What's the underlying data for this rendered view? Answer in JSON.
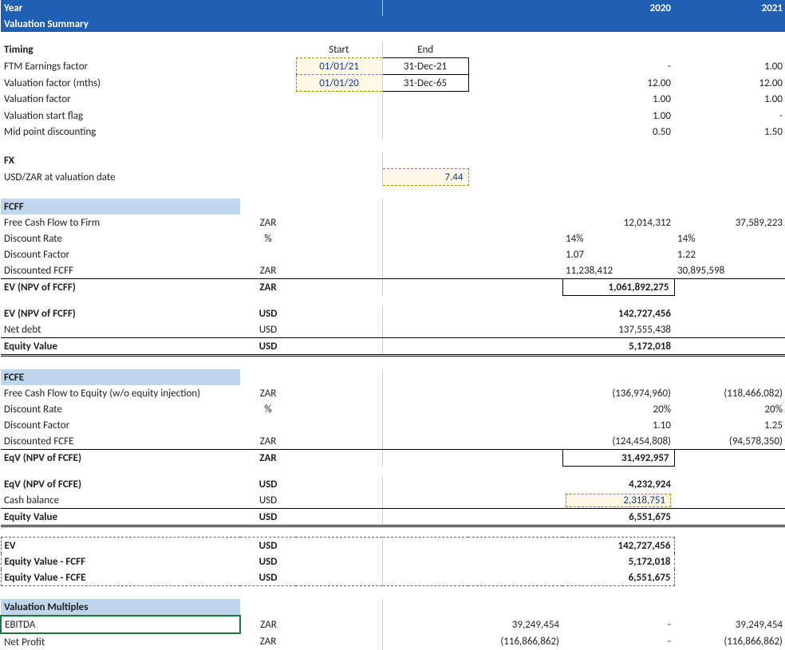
{
  "headers": {
    "year": "Year",
    "y2020": "2020",
    "y2021": "2021",
    "valsummary": "Valuation Summary"
  },
  "timing": {
    "title": "Timing",
    "start": "Start",
    "end": "End",
    "ftm": {
      "label": "FTM Earnings factor",
      "start": "01/01/21",
      "end": "31-Dec-21",
      "y20": "-",
      "y21": "1.00"
    },
    "vfMths": {
      "label": "Valuation factor (mths)",
      "start": "01/01/20",
      "end": "31-Dec-65",
      "y20": "12.00",
      "y21": "12.00"
    },
    "vf": {
      "label": "Valuation factor",
      "y20": "1.00",
      "y21": "1.00"
    },
    "vsFlag": {
      "label": "Valuation start flag",
      "y20": "1.00",
      "y21": "-"
    },
    "midpt": {
      "label": "Mid point discounting",
      "y20": "0.50",
      "y21": "1.50"
    }
  },
  "fx": {
    "title": "FX",
    "rate": {
      "label": "USD/ZAR at valuation date",
      "val": "7.44"
    }
  },
  "fcff": {
    "title": "FCFF",
    "free": {
      "label": "Free Cash Flow to Firm",
      "unit": "ZAR",
      "y20": "12,014,312",
      "y21": "37,589,223"
    },
    "drate": {
      "label": "Discount Rate",
      "unit": "%",
      "y20": "14%",
      "y21": "14%"
    },
    "dfact": {
      "label": "Discount Factor",
      "y20": "1.07",
      "y21": "1.22"
    },
    "disc": {
      "label": "Discounted FCFF",
      "unit": "ZAR",
      "y20": "11,238,412",
      "y21": "30,895,598"
    },
    "ev": {
      "label": "EV (NPV of FCFF)",
      "unit": "ZAR",
      "y20": "1,061,892,275"
    },
    "evUsd": {
      "label": "EV (NPV of FCFF)",
      "unit": "USD",
      "y20": "142,727,456"
    },
    "netdebt": {
      "label": "Net debt",
      "unit": "USD",
      "y20": "137,555,438"
    },
    "eqv": {
      "label": "Equity Value",
      "unit": "USD",
      "y20": "5,172,018"
    }
  },
  "fcfe": {
    "title": "FCFE",
    "free": {
      "label": "Free Cash Flow to Equity (w/o equity injection)",
      "unit": "ZAR",
      "y20": "(136,974,960)",
      "y21": "(118,466,082)"
    },
    "drate": {
      "label": "Discount Rate",
      "unit": "%",
      "y20": "20%",
      "y21": "20%"
    },
    "dfact": {
      "label": "Discount Factor",
      "y20": "1.10",
      "y21": "1.25"
    },
    "disc": {
      "label": "Discounted FCFE",
      "unit": "ZAR",
      "y20": "(124,454,808)",
      "y21": "(94,578,350)"
    },
    "eqv": {
      "label": "EqV (NPV of FCFE)",
      "unit": "ZAR",
      "y20": "31,492,957"
    },
    "eqvUsd": {
      "label": "EqV (NPV of FCFE)",
      "unit": "USD",
      "y20": "4,232,924"
    },
    "cash": {
      "label": "Cash balance",
      "unit": "USD",
      "y20": "2,318,751"
    },
    "equity": {
      "label": "Equity Value",
      "unit": "USD",
      "y20": "6,551,675"
    }
  },
  "summary": {
    "ev": {
      "label": "EV",
      "unit": "USD",
      "y20": "142,727,456"
    },
    "eqvFcff": {
      "label": "Equity Value - FCFF",
      "unit": "USD",
      "y20": "5,172,018"
    },
    "eqvFcfe": {
      "label": "Equity Value - FCFE",
      "unit": "USD",
      "y20": "6,551,675"
    }
  },
  "multiples": {
    "title": "Valuation Multiples",
    "ebitda": {
      "label": "EBITDA",
      "unit": "ZAR",
      "total": "39,249,454",
      "y20": "-",
      "y21": "39,249,454"
    },
    "netprofit": {
      "label": "Net Profit",
      "unit": "ZAR",
      "total": "(116,866,862)",
      "y20": "-",
      "y21": "(116,866,862)"
    }
  }
}
